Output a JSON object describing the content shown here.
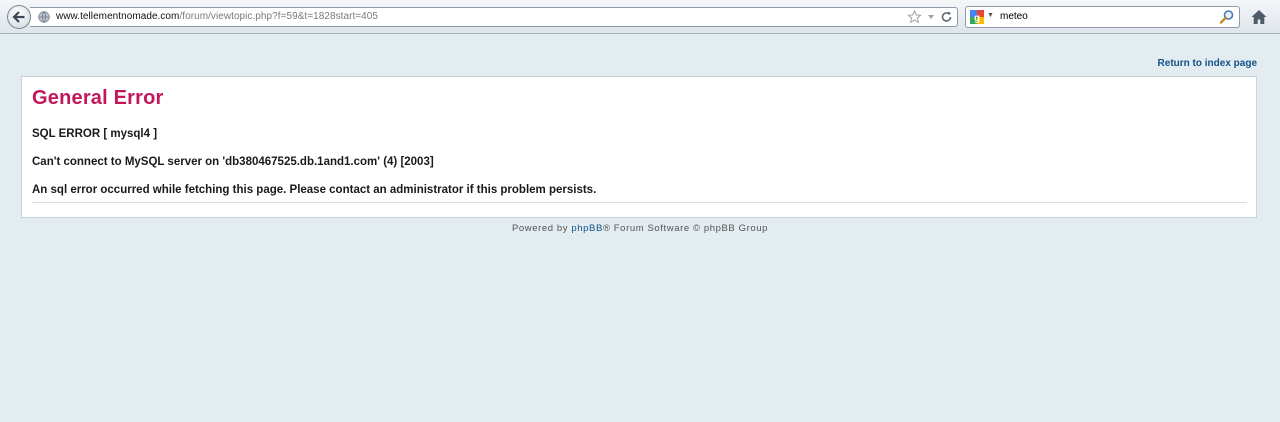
{
  "browser": {
    "url_host": "www.tellementnomade.com",
    "url_path": "/forum/viewtopic.php?f=59&t=1828start=405",
    "search_value": "meteo",
    "icons": {
      "back": "back-arrow-icon",
      "site": "globe-icon",
      "bookmark": "star-icon",
      "dropdown": "chevron-down-icon",
      "reload": "reload-icon",
      "engine": "google-icon",
      "search": "magnifier-icon",
      "home": "home-icon"
    }
  },
  "page": {
    "return_link": "Return to index page",
    "error_title": "General Error",
    "messages": [
      "SQL ERROR [ mysql4 ]",
      "Can't connect to MySQL server on 'db380467525.db.1and1.com' (4) [2003]",
      "An sql error occurred while fetching this page. Please contact an administrator if this problem persists."
    ],
    "footer": {
      "prefix": "Powered by ",
      "link": "phpBB",
      "suffix": "® Forum Software © phpBB Group"
    }
  },
  "colors": {
    "page_bg": "#e3ecf0",
    "title": "#c2185b",
    "link": "#105289"
  }
}
